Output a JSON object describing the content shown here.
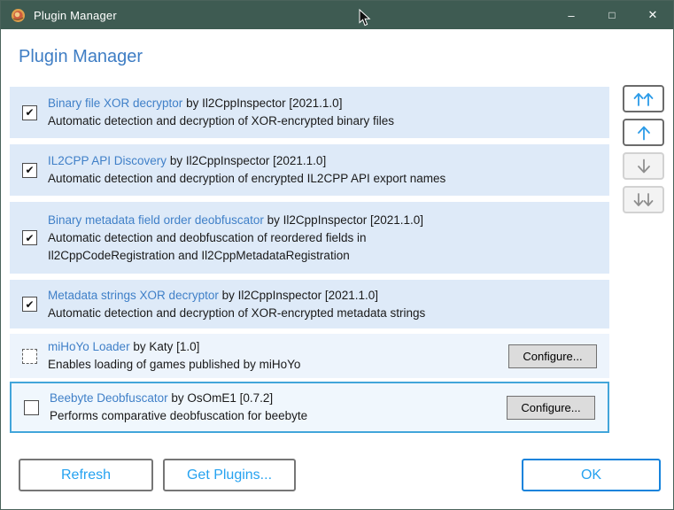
{
  "colors": {
    "titlebar-bg": "#3e5b52",
    "accent-link": "#4080c8",
    "selection-border": "#42a5da",
    "button-blue": "#25a2f0",
    "ok-border": "#1583dc",
    "row-bg": "#deeaf8",
    "row-bg-light": "#edf4fc",
    "row-bg-selected": "#f0f7fd"
  },
  "window": {
    "title": "Plugin Manager",
    "minimize_glyph": "–",
    "maximize_glyph": "□",
    "close_glyph": "✕"
  },
  "header": {
    "title": "Plugin Manager"
  },
  "plugins": [
    {
      "name": "Binary file XOR decryptor",
      "byline": "by Il2CppInspector [2021.1.0]",
      "description": "Automatic detection and decryption of XOR-encrypted binary files",
      "checked": "✔"
    },
    {
      "name": "IL2CPP API Discovery",
      "byline": "by Il2CppInspector [2021.1.0]",
      "description": "Automatic detection and decryption of encrypted IL2CPP API export names",
      "checked": "✔"
    },
    {
      "name": "Binary metadata field order deobfuscator",
      "byline": "by Il2CppInspector [2021.1.0]",
      "description": "Automatic detection and deobfuscation of reordered fields in\nIl2CppCodeRegistration and Il2CppMetadataRegistration",
      "checked": "✔"
    },
    {
      "name": "Metadata strings XOR decryptor",
      "byline": "by Il2CppInspector [2021.1.0]",
      "description": "Automatic detection and decryption of XOR-encrypted metadata strings",
      "checked": "✔"
    },
    {
      "name": "miHoYo Loader",
      "byline": "by Katy [1.0]",
      "description": "Enables loading of games published by miHoYo",
      "checked": "",
      "configure_label": "Configure..."
    },
    {
      "name": "Beebyte Deobfuscator",
      "byline": "by OsOmE1 [0.7.2]",
      "description": "Performs comparative deobfuscation for beebyte",
      "checked": "",
      "configure_label": "Configure..."
    }
  ],
  "reorder_buttons": [
    {
      "name": "move-to-top",
      "enabled": true
    },
    {
      "name": "move-up",
      "enabled": true
    },
    {
      "name": "move-down",
      "enabled": false
    },
    {
      "name": "move-to-bottom",
      "enabled": false
    }
  ],
  "footer": {
    "refresh_label": "Refresh",
    "get_plugins_label": "Get Plugins...",
    "ok_label": "OK"
  }
}
